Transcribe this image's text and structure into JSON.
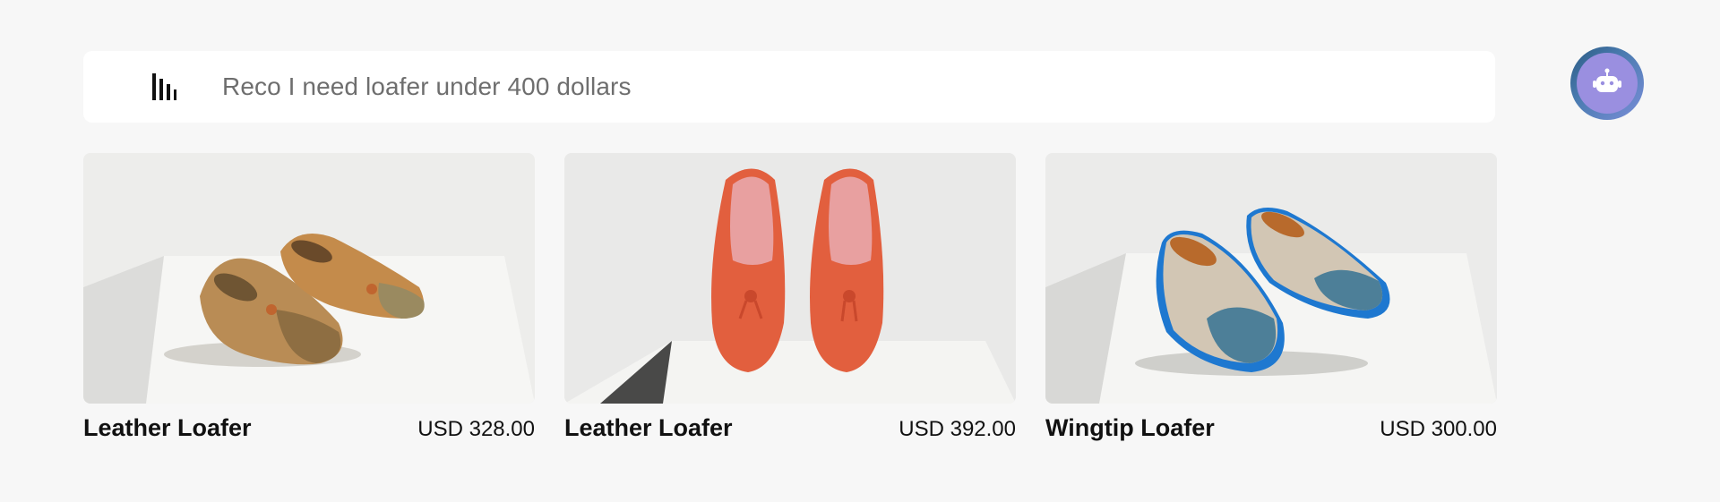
{
  "search": {
    "value": "Reco I need loafer under 400 dollars"
  },
  "assistant": {
    "icon": "robot-icon"
  },
  "brand": {
    "icon": "bars-logo-icon"
  },
  "products": [
    {
      "title": "Leather Loafer",
      "price": "USD 328.00",
      "color": "#c0874a"
    },
    {
      "title": "Leather Loafer",
      "price": "USD 392.00",
      "color": "#e05a3a"
    },
    {
      "title": "Wingtip Loafer",
      "price": "USD 300.00",
      "color": "#3d7fa8"
    }
  ]
}
